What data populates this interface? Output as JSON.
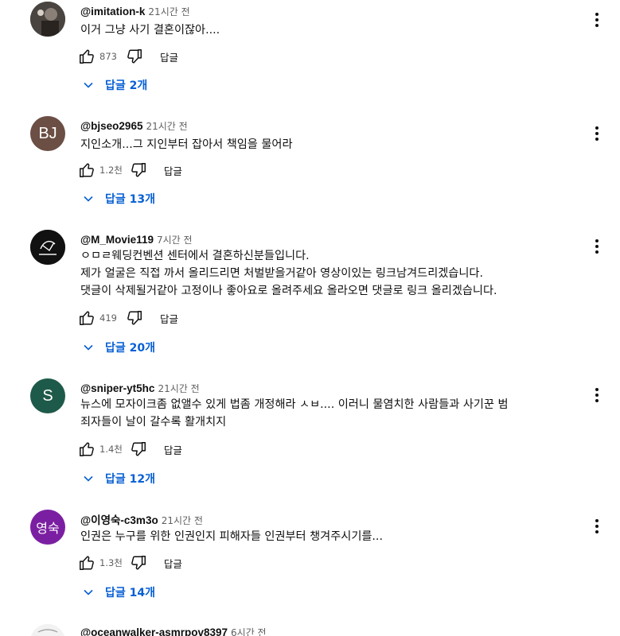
{
  "labels": {
    "reply": "답글",
    "replies_prefix": "답글 "
  },
  "comments": [
    {
      "author": "@imitation-k",
      "time": "21시간 전",
      "lines": [
        "이거 그냥 사기 결혼이잖아...."
      ],
      "likes": "873",
      "replies": "답글 2개",
      "avatar_text": "",
      "avatar_color": "#3a3a3a"
    },
    {
      "author": "@bjseo2965",
      "time": "21시간 전",
      "lines": [
        "지인소개...그 지인부터 잡아서 책임을 물어라"
      ],
      "likes": "1.2천",
      "replies": "답글 13개",
      "avatar_text": "BJ",
      "avatar_color": "#6b4e44"
    },
    {
      "author": "@M_Movie119",
      "time": "7시간 전",
      "lines": [
        "ㅇㅁㄹ웨딩컨벤션 센터에서 결혼하신분들입니다.",
        "제가 얼굴은 직접 까서 올리드리면 처벌받을거같아 영상이있는 링크남겨드리겠습니다.",
        "댓글이 삭제될거같아 고정이나 좋아요로 올려주세요 올라오면 댓글로 링크 올리겠습니다."
      ],
      "likes": "419",
      "replies": "답글 20개",
      "avatar_text": "",
      "avatar_color": "#111111"
    },
    {
      "author": "@sniper-yt5hc",
      "time": "21시간 전",
      "lines": [
        "뉴스에 모자이크좀 없앨수 있게 법좀 개정해라 ㅅㅂ.... 이러니 물염치한 사람들과 사기꾼 범",
        "죄자들이 날이 갈수록 활개치지"
      ],
      "likes": "1.4천",
      "replies": "답글 12개",
      "avatar_text": "S",
      "avatar_color": "#1e5a49"
    },
    {
      "author": "@이영숙-c3m3o",
      "time": "21시간 전",
      "lines": [
        "인권은 누구를 위한 인권인지 피해자들 인권부터 챙겨주시기를..."
      ],
      "likes": "1.3천",
      "replies": "답글 14개",
      "avatar_text": "영숙",
      "avatar_color": "#7b1fa2"
    },
    {
      "author": "@oceanwalker-asmrpov8397",
      "time": "6시간 전",
      "lines": [],
      "likes": "",
      "replies": "",
      "avatar_text": "",
      "avatar_color": "#eeeeee"
    }
  ],
  "icons": {
    "like": "thumb-up-icon",
    "dislike": "thumb-down-icon",
    "more": "more-vert-icon",
    "expand": "chevron-down-icon"
  },
  "colors": {
    "link_blue": "#065fd4",
    "meta_gray": "#606060"
  }
}
